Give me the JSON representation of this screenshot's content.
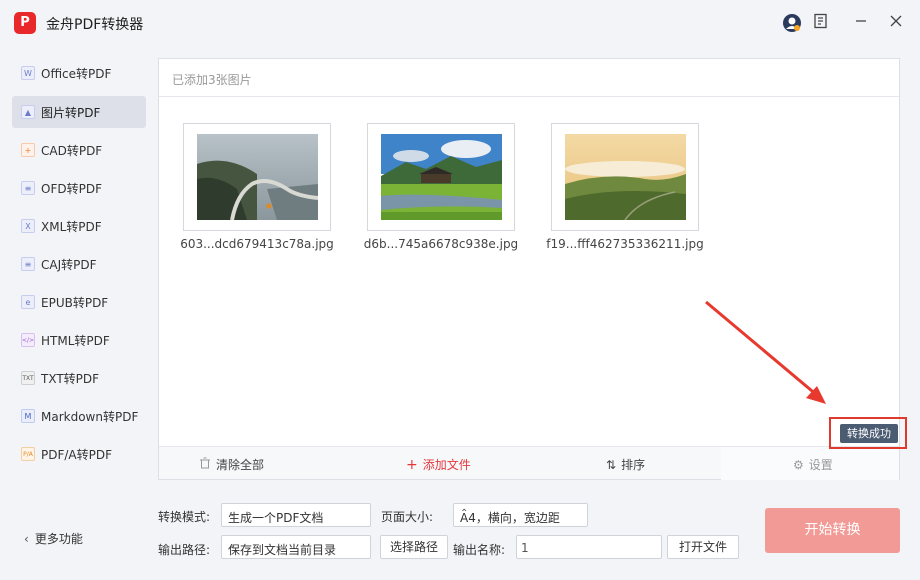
{
  "app": {
    "title": "金舟PDF转换器",
    "logo_glyph": "P"
  },
  "sidebar": {
    "items": [
      {
        "label": "Office转PDF",
        "icon": "W"
      },
      {
        "label": "图片转PDF",
        "icon": "▲"
      },
      {
        "label": "CAD转PDF",
        "icon": "+"
      },
      {
        "label": "OFD转PDF",
        "icon": "≡"
      },
      {
        "label": "XML转PDF",
        "icon": "X"
      },
      {
        "label": "CAJ转PDF",
        "icon": "≡"
      },
      {
        "label": "EPUB转PDF",
        "icon": "e"
      },
      {
        "label": "HTML转PDF",
        "icon": "</>"
      },
      {
        "label": "TXT转PDF",
        "icon": "TXT"
      },
      {
        "label": "Markdown转PDF",
        "icon": "M"
      },
      {
        "label": "PDF/A转PDF",
        "icon": "P/A"
      }
    ],
    "active_index": 1,
    "more": "更多功能"
  },
  "panel": {
    "header": "已添加3张图片",
    "files": [
      {
        "name": "603...dcd679413c78a.jpg"
      },
      {
        "name": "d6b...745a6678c938e.jpg"
      },
      {
        "name": "f19...fff462735336211.jpg"
      }
    ],
    "toast": "转换成功",
    "toolbar": {
      "clear": "清除全部",
      "add": "添加文件",
      "sort": "排序",
      "settings": "设置"
    }
  },
  "options": {
    "mode_label": "转换模式:",
    "mode_value": "生成一个PDF文档",
    "page_size_label": "页面大小:",
    "page_size_value": "A4，横向，宽边距",
    "output_path_label": "输出路径:",
    "output_path_value": "保存到文档当前目录",
    "choose_path": "选择路径",
    "output_name_label": "输出名称:",
    "output_name_value": "1",
    "open_file": "打开文件",
    "start": "开始转换"
  },
  "colors": {
    "accent_red": "#e4393c",
    "start_button": "#f29a95",
    "toast_bg": "#4b5c72"
  }
}
